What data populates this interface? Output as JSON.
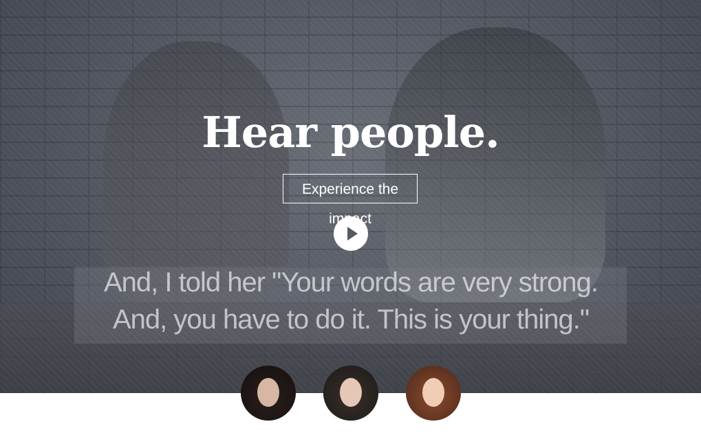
{
  "hero": {
    "title": "Hear people.",
    "cta_label": "Experience the impact",
    "quote": "And, I told her \"Your words are very strong. And, you have to do it. This is your thing.\""
  },
  "icons": {
    "play": "play-icon"
  },
  "colors": {
    "overlay": "#555a63",
    "text": "#ffffff",
    "page_background": "#ffffff"
  },
  "testimonials": [
    {
      "id": "avatar-1"
    },
    {
      "id": "avatar-2"
    },
    {
      "id": "avatar-3"
    }
  ]
}
